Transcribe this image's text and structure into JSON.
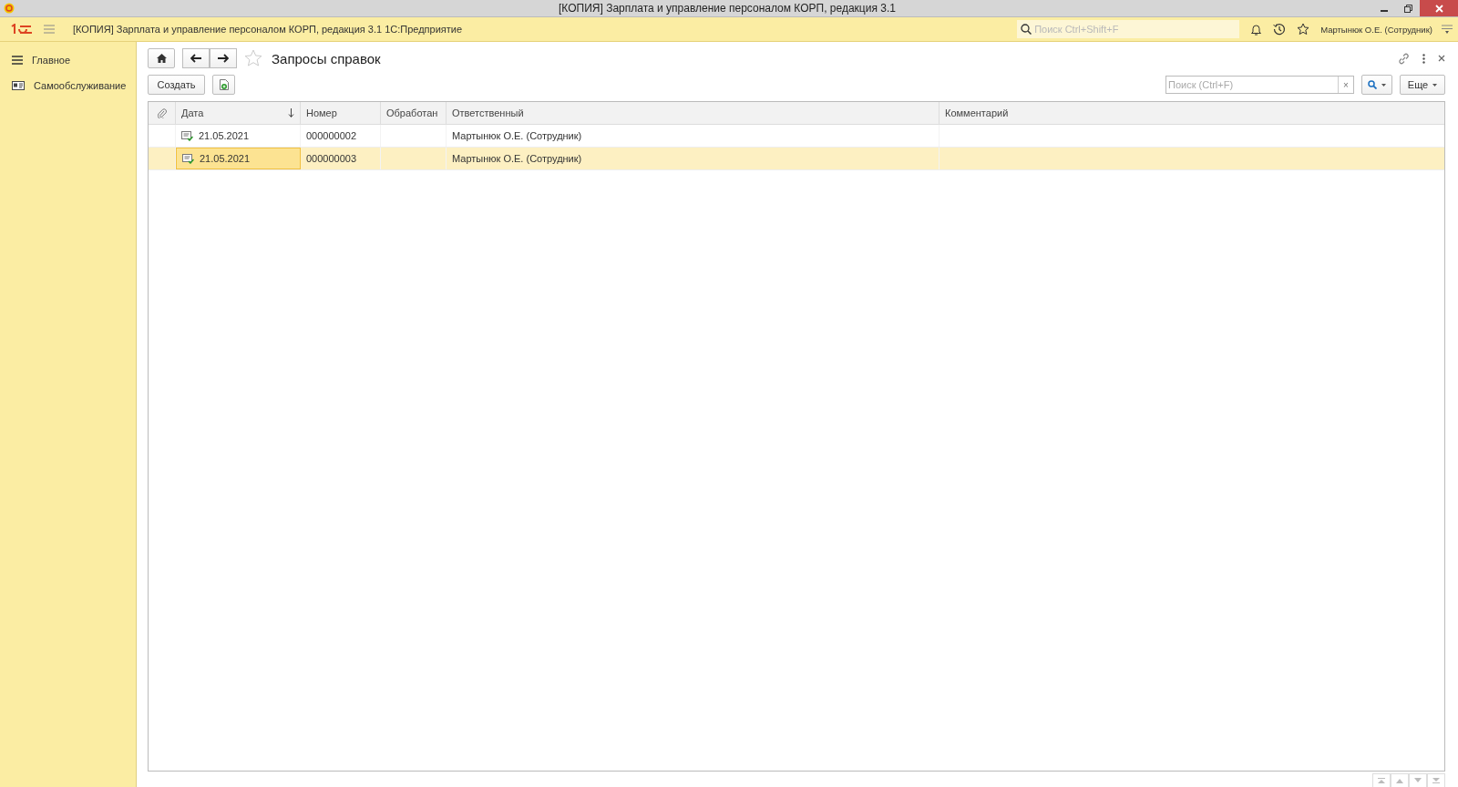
{
  "window": {
    "title": "[КОПИЯ] Зарплата и управление персоналом КОРП, редакция 3.1"
  },
  "app_bar": {
    "title": "[КОПИЯ] Зарплата и управление персоналом КОРП, редакция 3.1 1С:Предприятие",
    "search": {
      "placeholder": "Поиск Ctrl+Shift+F"
    },
    "user": "Мартынюк О.Е. (Сотрудник)"
  },
  "sidebar": {
    "items": [
      {
        "label": "Главное",
        "selected": false
      },
      {
        "label": "Самообслуживание",
        "selected": false
      }
    ]
  },
  "form": {
    "title": "Запросы справок",
    "create_button": "Создать",
    "search": {
      "placeholder": "Поиск (Ctrl+F)"
    },
    "clear_button": "×",
    "more_button": "Еще"
  },
  "table": {
    "columns": [
      {
        "label": "Дата",
        "sorted": true
      },
      {
        "label": "Номер",
        "sorted": false
      },
      {
        "label": "Обработан",
        "sorted": false
      },
      {
        "label": "Ответственный",
        "sorted": false
      },
      {
        "label": "Комментарий",
        "sorted": false
      }
    ],
    "rows": [
      {
        "date": "21.05.2021",
        "number": "000000002",
        "responsible": "Мартынюк О.Е. (Сотрудник)",
        "selected": false
      },
      {
        "date": "21.05.2021",
        "number": "000000003",
        "responsible": "Мартынюк О.Е. (Сотрудник)",
        "selected": true
      }
    ]
  }
}
